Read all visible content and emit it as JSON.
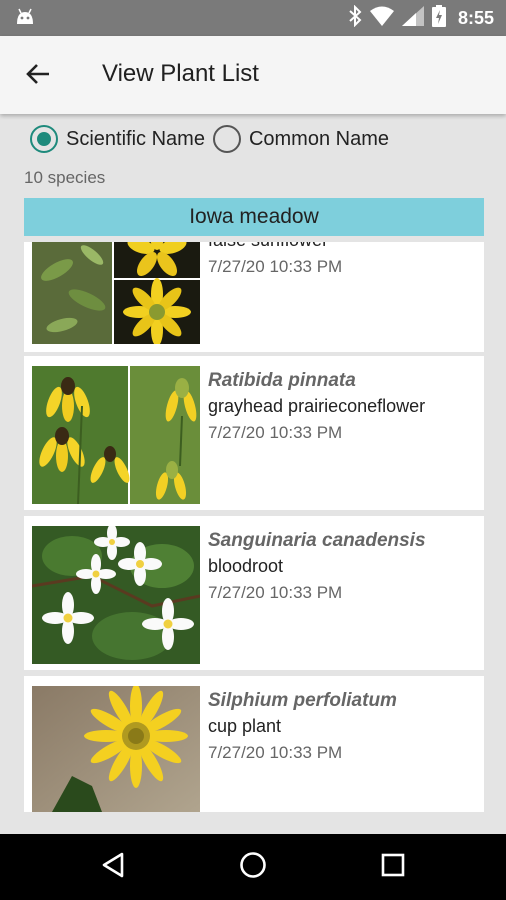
{
  "status_bar": {
    "time": "8:55",
    "icons": [
      "android-icon",
      "bluetooth-icon",
      "wifi-icon",
      "signal-icon",
      "battery-charging-icon"
    ]
  },
  "app_bar": {
    "title": "View Plant List",
    "back_icon": "arrow-back-icon"
  },
  "filter": {
    "options": [
      {
        "label": "Scientific Name",
        "selected": true
      },
      {
        "label": "Common Name",
        "selected": false
      }
    ],
    "accent_color": "#1e8a7c"
  },
  "species_count": "10 species",
  "list_header": {
    "title": "Iowa meadow",
    "color": "#7ecfdc"
  },
  "plants": [
    {
      "scientific": "",
      "common": "false sunflower",
      "date": "7/27/20 10:33 PM"
    },
    {
      "scientific": "Ratibida pinnata",
      "common": "grayhead prairieconeflower",
      "date": "7/27/20 10:33 PM"
    },
    {
      "scientific": "Sanguinaria canadensis",
      "common": "bloodroot",
      "date": "7/27/20 10:33 PM"
    },
    {
      "scientific": "Silphium perfoliatum",
      "common": "cup plant",
      "date": "7/27/20 10:33 PM"
    }
  ],
  "nav_bar": {
    "icons": [
      "back-triangle-icon",
      "home-circle-icon",
      "recents-square-icon"
    ]
  }
}
